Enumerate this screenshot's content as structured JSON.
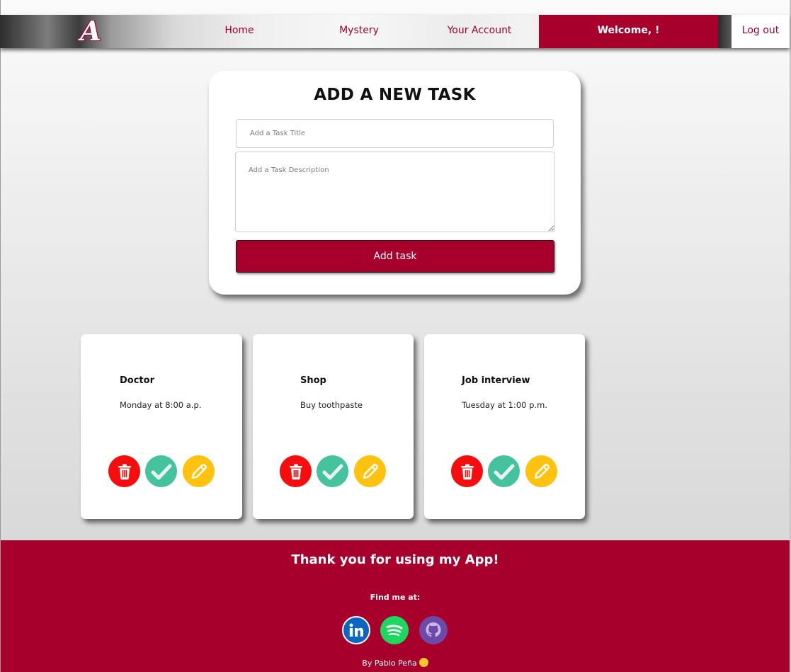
{
  "nav": {
    "logo_text": "A",
    "links": [
      "Home",
      "Mystery",
      "Your Account"
    ],
    "welcome": "Welcome, !",
    "logout": "Log out"
  },
  "add_task": {
    "heading": "ADD A NEW TASK",
    "title_placeholder": "Add a Task Title",
    "description_placeholder": "Add a Task Description",
    "button_label": "Add task"
  },
  "tasks": [
    {
      "title": "Doctor",
      "description": "Monday at 8:00 a.p."
    },
    {
      "title": "Shop",
      "description": "Buy toothpaste"
    },
    {
      "title": "Job interview",
      "description": "Tuesday at 1:00 p.m."
    }
  ],
  "task_actions": {
    "delete_icon": "trash-icon",
    "complete_icon": "check-icon",
    "edit_icon": "pencil-icon",
    "delete_color": "#f70d0d",
    "complete_color": "#45c39e",
    "edit_color": "#ffc20f"
  },
  "footer": {
    "thanks": "Thank you for using my App!",
    "find_me": "Find me at:",
    "socials": [
      "linkedin-icon",
      "spotify-icon",
      "github-icon"
    ],
    "byline": "By Pablo Peña"
  },
  "colors": {
    "accent": "#a8002d",
    "footer_bg": "#a8002d"
  }
}
